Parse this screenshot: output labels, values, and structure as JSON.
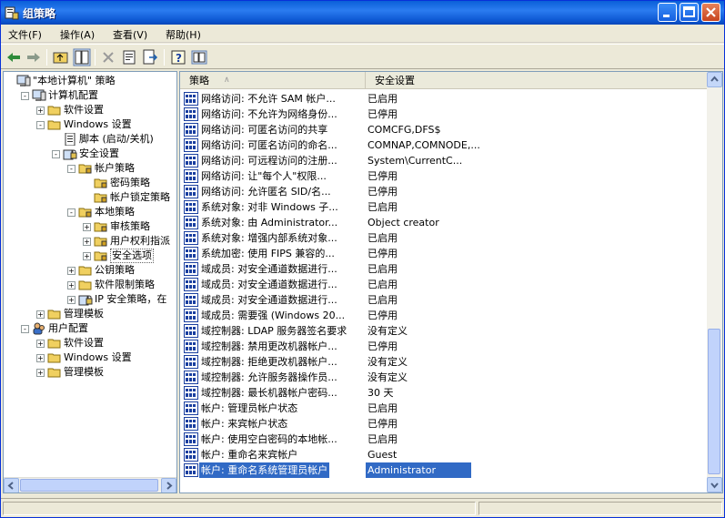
{
  "window": {
    "title": "组策略"
  },
  "menu": [
    "文件(F)",
    "操作(A)",
    "查看(V)",
    "帮助(H)"
  ],
  "toolbar": {
    "icons": [
      "back-icon",
      "forward-icon",
      "up-folder-icon",
      "show-tree-icon",
      "delete-icon",
      "properties-icon",
      "export-icon",
      "help-icon",
      "console-tree-icon"
    ]
  },
  "tree": [
    {
      "label": "\"本地计算机\" 策略",
      "depth": 0,
      "exp": "",
      "icon": "computer-policy-icon"
    },
    {
      "label": "计算机配置",
      "depth": 1,
      "exp": "-",
      "icon": "computer-icon"
    },
    {
      "label": "软件设置",
      "depth": 2,
      "exp": "+",
      "icon": "folder-icon"
    },
    {
      "label": "Windows 设置",
      "depth": 2,
      "exp": "-",
      "icon": "folder-icon"
    },
    {
      "label": "脚本 (启动/关机)",
      "depth": 3,
      "exp": "",
      "icon": "script-icon"
    },
    {
      "label": "安全设置",
      "depth": 3,
      "exp": "-",
      "icon": "security-icon"
    },
    {
      "label": "帐户策略",
      "depth": 4,
      "exp": "-",
      "icon": "folder-lock-icon"
    },
    {
      "label": "密码策略",
      "depth": 5,
      "exp": "",
      "icon": "folder-lock-icon"
    },
    {
      "label": "帐户锁定策略",
      "depth": 5,
      "exp": "",
      "icon": "folder-lock-icon"
    },
    {
      "label": "本地策略",
      "depth": 4,
      "exp": "-",
      "icon": "folder-lock-icon"
    },
    {
      "label": "审核策略",
      "depth": 5,
      "exp": "+",
      "icon": "folder-lock-icon"
    },
    {
      "label": "用户权利指派",
      "depth": 5,
      "exp": "+",
      "icon": "folder-lock-icon"
    },
    {
      "label": "安全选项",
      "depth": 5,
      "exp": "+",
      "icon": "folder-lock-icon"
    },
    {
      "label": "公钥策略",
      "depth": 4,
      "exp": "+",
      "icon": "folder-icon"
    },
    {
      "label": "软件限制策略",
      "depth": 4,
      "exp": "+",
      "icon": "folder-icon"
    },
    {
      "label": "IP 安全策略，在",
      "depth": 4,
      "exp": "+",
      "icon": "ip-security-icon"
    },
    {
      "label": "管理模板",
      "depth": 2,
      "exp": "+",
      "icon": "folder-icon"
    },
    {
      "label": "用户配置",
      "depth": 1,
      "exp": "-",
      "icon": "user-icon"
    },
    {
      "label": "软件设置",
      "depth": 2,
      "exp": "+",
      "icon": "folder-icon"
    },
    {
      "label": "Windows 设置",
      "depth": 2,
      "exp": "+",
      "icon": "folder-icon"
    },
    {
      "label": "管理模板",
      "depth": 2,
      "exp": "+",
      "icon": "folder-icon"
    }
  ],
  "list": {
    "columns": [
      "策略",
      "安全设置"
    ],
    "rows": [
      {
        "policy": "网络访问: 不允许 SAM 帐户...",
        "setting": "已启用"
      },
      {
        "policy": "网络访问: 不允许为网络身份...",
        "setting": "已停用"
      },
      {
        "policy": "网络访问: 可匿名访问的共享",
        "setting": "COMCFG,DFS$"
      },
      {
        "policy": "网络访问: 可匿名访问的命名...",
        "setting": "COMNAP,COMNODE,..."
      },
      {
        "policy": "网络访问: 可远程访问的注册...",
        "setting": "System\\CurrentC..."
      },
      {
        "policy": "网络访问: 让\"每个人\"权限...",
        "setting": "已停用"
      },
      {
        "policy": "网络访问: 允许匿名 SID/名...",
        "setting": "已停用"
      },
      {
        "policy": "系统对象: 对非 Windows 子...",
        "setting": "已启用"
      },
      {
        "policy": "系统对象: 由 Administrator...",
        "setting": "Object creator"
      },
      {
        "policy": "系统对象: 增强内部系统对象...",
        "setting": "已启用"
      },
      {
        "policy": "系统加密: 使用 FIPS 兼容的...",
        "setting": "已停用"
      },
      {
        "policy": "域成员: 对安全通道数据进行...",
        "setting": "已启用"
      },
      {
        "policy": "域成员: 对安全通道数据进行...",
        "setting": "已启用"
      },
      {
        "policy": "域成员: 对安全通道数据进行...",
        "setting": "已启用"
      },
      {
        "policy": "域成员: 需要强 (Windows 20...",
        "setting": "已停用"
      },
      {
        "policy": "域控制器: LDAP 服务器签名要求",
        "setting": "没有定义"
      },
      {
        "policy": "域控制器: 禁用更改机器帐户...",
        "setting": "已停用"
      },
      {
        "policy": "域控制器: 拒绝更改机器帐户...",
        "setting": "没有定义"
      },
      {
        "policy": "域控制器: 允许服务器操作员...",
        "setting": "没有定义"
      },
      {
        "policy": "域控制器: 最长机器帐户密码...",
        "setting": "30 天"
      },
      {
        "policy": "帐户: 管理员帐户状态",
        "setting": "已启用"
      },
      {
        "policy": "帐户: 来宾帐户状态",
        "setting": "已停用"
      },
      {
        "policy": "帐户: 使用空白密码的本地帐...",
        "setting": "已启用"
      },
      {
        "policy": "帐户: 重命名来宾帐户",
        "setting": "Guest"
      },
      {
        "policy": "帐户: 重命名系统管理员帐户",
        "setting": "Administrator"
      }
    ]
  },
  "colors": {
    "selection": "#316ac5",
    "title": "#0a5fd8"
  }
}
